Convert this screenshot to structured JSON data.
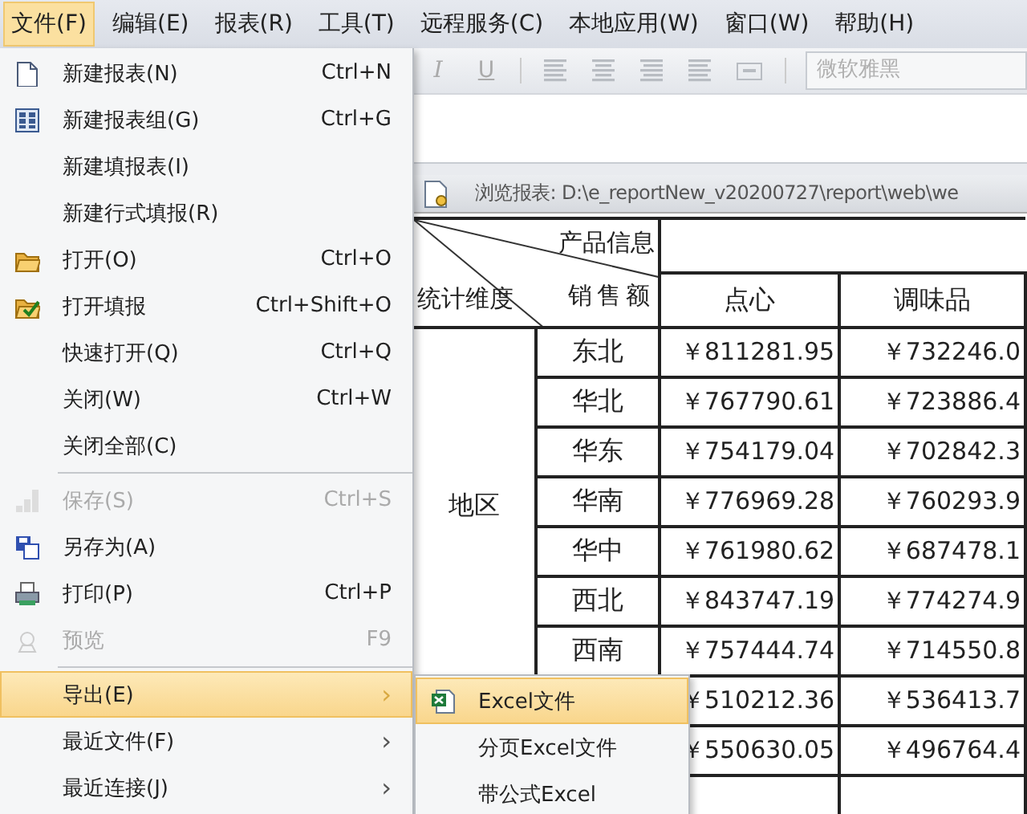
{
  "menubar": [
    {
      "label": "文件(F)",
      "selected": true
    },
    {
      "label": "编辑(E)",
      "selected": false
    },
    {
      "label": "报表(R)",
      "selected": false
    },
    {
      "label": "工具(T)",
      "selected": false
    },
    {
      "label": "远程服务(C)",
      "selected": false
    },
    {
      "label": "本地应用(W)",
      "selected": false
    },
    {
      "label": "窗口(W)",
      "selected": false
    },
    {
      "label": "帮助(H)",
      "selected": false
    }
  ],
  "toolbar": {
    "buttons": [
      "I",
      "U"
    ],
    "font_field": {
      "value": "微软雅黑"
    }
  },
  "report_window": {
    "title": "浏览报表: D:\\e_reportNew_v20200727\\report\\web\\we",
    "table": {
      "corner": {
        "top": "产品信息",
        "middle": "销售额",
        "left": "统计维度"
      },
      "columns": [
        "点心",
        "调味品"
      ],
      "dimension": "地区",
      "rows": [
        {
          "region": "东北",
          "values": [
            "￥811281.95",
            "￥732246.0"
          ]
        },
        {
          "region": "华北",
          "values": [
            "￥767790.61",
            "￥723886.4"
          ]
        },
        {
          "region": "华东",
          "values": [
            "￥754179.04",
            "￥702842.3"
          ]
        },
        {
          "region": "华南",
          "values": [
            "￥776969.28",
            "￥760293.9"
          ]
        },
        {
          "region": "华中",
          "values": [
            "￥761980.62",
            "￥687478.1"
          ]
        },
        {
          "region": "西北",
          "values": [
            "￥843747.19",
            "￥774274.9"
          ]
        },
        {
          "region": "西南",
          "values": [
            "￥757444.74",
            "￥714550.8"
          ]
        },
        {
          "values": [
            "￥510212.36",
            "￥536413.7"
          ]
        },
        {
          "values": [
            "￥550630.05",
            "￥496764.4"
          ]
        }
      ]
    }
  },
  "file_menu": {
    "items": [
      {
        "kind": "item",
        "label": "新建报表(N)",
        "shortcut": "Ctrl+N",
        "disabled": false,
        "selected": false
      },
      {
        "kind": "item",
        "label": "新建报表组(G)",
        "shortcut": "Ctrl+G",
        "disabled": false,
        "selected": false
      },
      {
        "kind": "item",
        "label": "新建填报表(I)",
        "disabled": false,
        "selected": false
      },
      {
        "kind": "item",
        "label": "新建行式填报(R)",
        "disabled": false,
        "selected": false
      },
      {
        "kind": "item",
        "label": "打开(O)",
        "shortcut": "Ctrl+O",
        "disabled": false,
        "selected": false
      },
      {
        "kind": "item",
        "label": "打开填报",
        "shortcut": "Ctrl+Shift+O",
        "disabled": false,
        "selected": false
      },
      {
        "kind": "item",
        "label": "快速打开(Q)",
        "shortcut": "Ctrl+Q",
        "disabled": false,
        "selected": false
      },
      {
        "kind": "item",
        "label": "关闭(W)",
        "shortcut": "Ctrl+W",
        "disabled": false,
        "selected": false
      },
      {
        "kind": "item",
        "label": "关闭全部(C)",
        "disabled": false,
        "selected": false
      },
      {
        "kind": "separator"
      },
      {
        "kind": "item",
        "label": "保存(S)",
        "shortcut": "Ctrl+S",
        "disabled": true,
        "selected": false
      },
      {
        "kind": "item",
        "label": "另存为(A)",
        "disabled": false,
        "selected": false
      },
      {
        "kind": "item",
        "label": "打印(P)",
        "shortcut": "Ctrl+P",
        "disabled": false,
        "selected": false
      },
      {
        "kind": "item",
        "label": "预览",
        "shortcut": "F9",
        "disabled": true,
        "selected": false
      },
      {
        "kind": "separator"
      },
      {
        "kind": "item",
        "label": "导出(E)",
        "arrow": "›",
        "disabled": false,
        "selected": true
      },
      {
        "kind": "item",
        "label": "最近文件(F)",
        "arrow": "›",
        "disabled": false,
        "selected": false
      },
      {
        "kind": "item",
        "label": "最近连接(J)",
        "arrow": "›",
        "disabled": false,
        "selected": false
      }
    ]
  },
  "export_submenu": {
    "items": [
      {
        "label": "Excel文件",
        "selected": true
      },
      {
        "label": "分页Excel文件",
        "selected": false
      },
      {
        "label": "带公式Excel",
        "selected": false
      }
    ]
  }
}
